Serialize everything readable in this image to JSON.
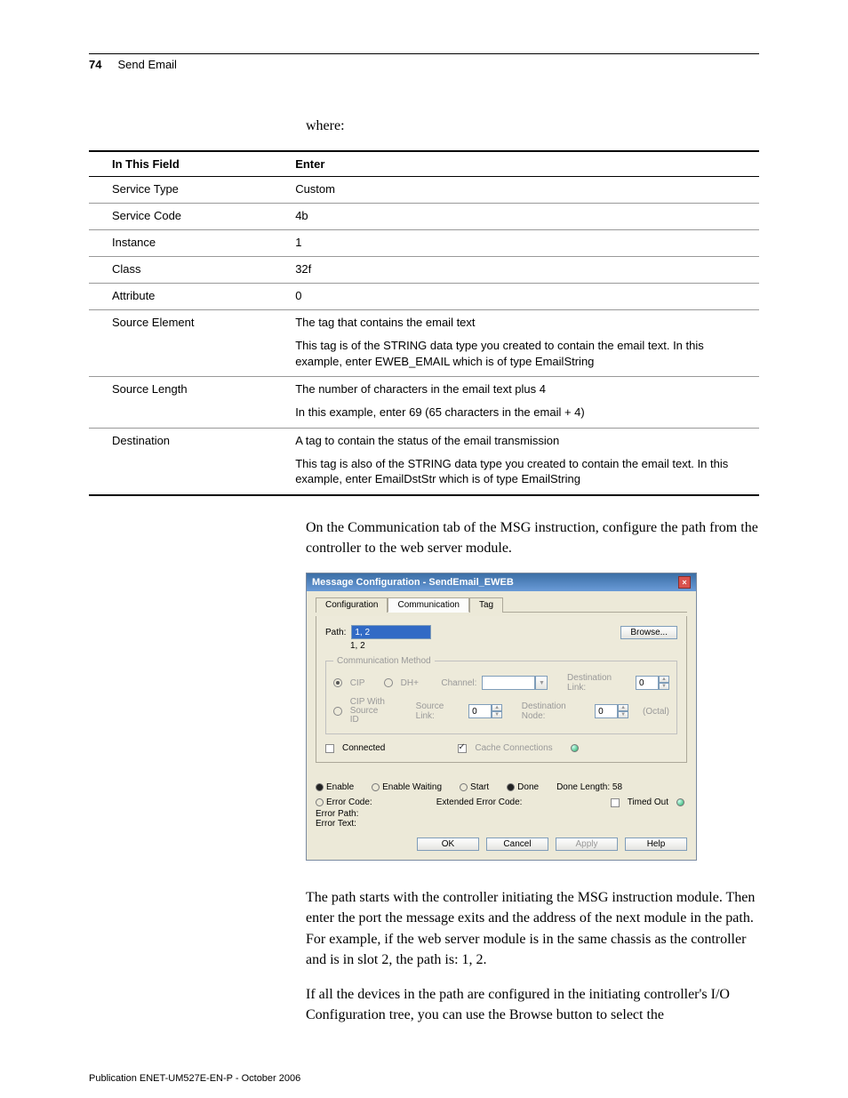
{
  "header": {
    "page_number": "74",
    "section_title": "Send Email"
  },
  "intro_where": "where:",
  "table": {
    "head": {
      "field": "In This Field",
      "enter": "Enter"
    },
    "rows": [
      {
        "field": "Service Type",
        "enter": "Custom"
      },
      {
        "field": "Service Code",
        "enter": "4b"
      },
      {
        "field": "Instance",
        "enter": "1"
      },
      {
        "field": "Class",
        "enter": "32f"
      },
      {
        "field": "Attribute",
        "enter": "0"
      },
      {
        "field": "Source Element",
        "enter": "The tag that contains the email text",
        "sub": "This tag is of the STRING data type you created to contain the email text. In this example, enter EWEB_EMAIL which is of type EmailString"
      },
      {
        "field": "Source Length",
        "enter": "The number of characters in the email text plus 4",
        "sub": "In this example, enter 69 (65 characters in the email + 4)"
      },
      {
        "field": "Destination",
        "enter": "A tag to contain the status of the email transmission",
        "sub": "This tag is also of the STRING data type you created to contain the email text. In this example, enter EmailDstStr which is of type EmailString"
      }
    ]
  },
  "para_before_dialog": "On the Communication tab of the MSG instruction, configure the path from the controller to the web server module.",
  "dialog": {
    "title": "Message Configuration - SendEmail_EWEB",
    "tabs": {
      "config": "Configuration",
      "comm": "Communication",
      "tag": "Tag"
    },
    "path_label": "Path:",
    "path_value": "1, 2",
    "path_echo": "1, 2",
    "browse": "Browse...",
    "comm_method_legend": "Communication Method",
    "opts": {
      "cip": "CIP",
      "dhp": "DH+",
      "channel": "Channel:",
      "cip_with": "CIP With",
      "source_id": "Source ID",
      "source_link": "Source Link:",
      "dest_link": "Destination Link:",
      "dest_node": "Destination Node:",
      "octal": "(Octal)",
      "zero": "0"
    },
    "connected": "Connected",
    "cache": "Cache Connections",
    "status": {
      "enable": "Enable",
      "enable_waiting": "Enable Waiting",
      "start": "Start",
      "done": "Done",
      "done_length_label": "Done Length:",
      "done_length_value": "58",
      "error_code": "Error Code:",
      "ext_error": "Extended Error Code:",
      "timed_out": "Timed Out",
      "error_path": "Error Path:",
      "error_text": "Error Text:"
    },
    "buttons": {
      "ok": "OK",
      "cancel": "Cancel",
      "apply": "Apply",
      "help": "Help"
    }
  },
  "para_after_dialog_1": "The path starts with the controller initiating the MSG instruction module. Then enter the port the message exits and the address of the next module in the path. For example, if the web server module is in the same chassis as the controller and is in slot 2, the path is: 1, 2.",
  "para_after_dialog_2": "If all the devices in the path are configured in the initiating controller's I/O Configuration tree, you can use the Browse button to select the",
  "footer": "Publication ENET-UM527E-EN-P - October 2006"
}
